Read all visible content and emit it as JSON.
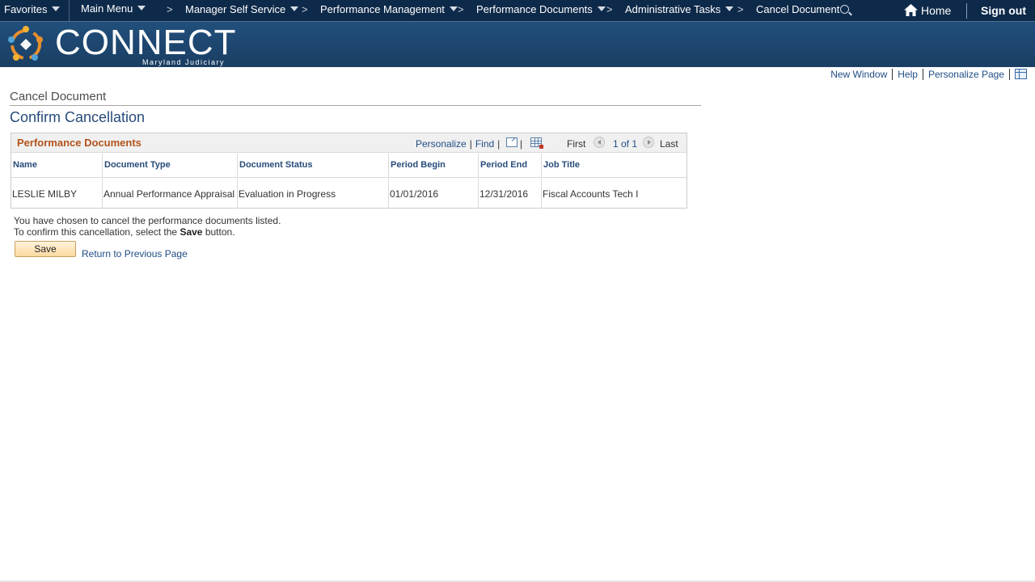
{
  "nav": {
    "favorites": "Favorites",
    "main_menu": "Main Menu",
    "breadcrumbs": [
      "Manager Self Service",
      "Performance Management",
      "Performance Documents",
      "Administrative Tasks"
    ],
    "current": "Cancel Document",
    "home": "Home",
    "sign_out": "Sign out"
  },
  "brand": {
    "name": "CONNECT",
    "sub": "Maryland Judiciary"
  },
  "page_links": {
    "new_window": "New Window",
    "help": "Help",
    "personalize_page": "Personalize Page"
  },
  "page": {
    "title": "Cancel Document",
    "subtitle": "Confirm Cancellation"
  },
  "grid": {
    "title": "Performance Documents",
    "personalize": "Personalize",
    "find": "Find",
    "first": "First",
    "pager": "1 of 1",
    "last": "Last",
    "columns": [
      "Name",
      "Document Type",
      "Document Status",
      "Period Begin",
      "Period End",
      "Job Title"
    ],
    "rows": [
      [
        "LESLIE MILBY",
        "Annual Performance Appraisal",
        "Evaluation in Progress",
        "01/01/2016",
        "12/31/2016",
        "Fiscal Accounts Tech I"
      ]
    ]
  },
  "message": {
    "line1": "You have chosen to cancel the performance documents listed.",
    "line2_pre": "To confirm this cancellation, select the",
    "line2_bold": "Save",
    "line2_post": "button."
  },
  "actions": {
    "save": "Save",
    "return": "Return to Previous Page"
  },
  "colors": {
    "nav_bg": "#0e2a4a",
    "banner": "#1f4a75",
    "link": "#1f4d84",
    "grid_title": "#b2531b"
  }
}
